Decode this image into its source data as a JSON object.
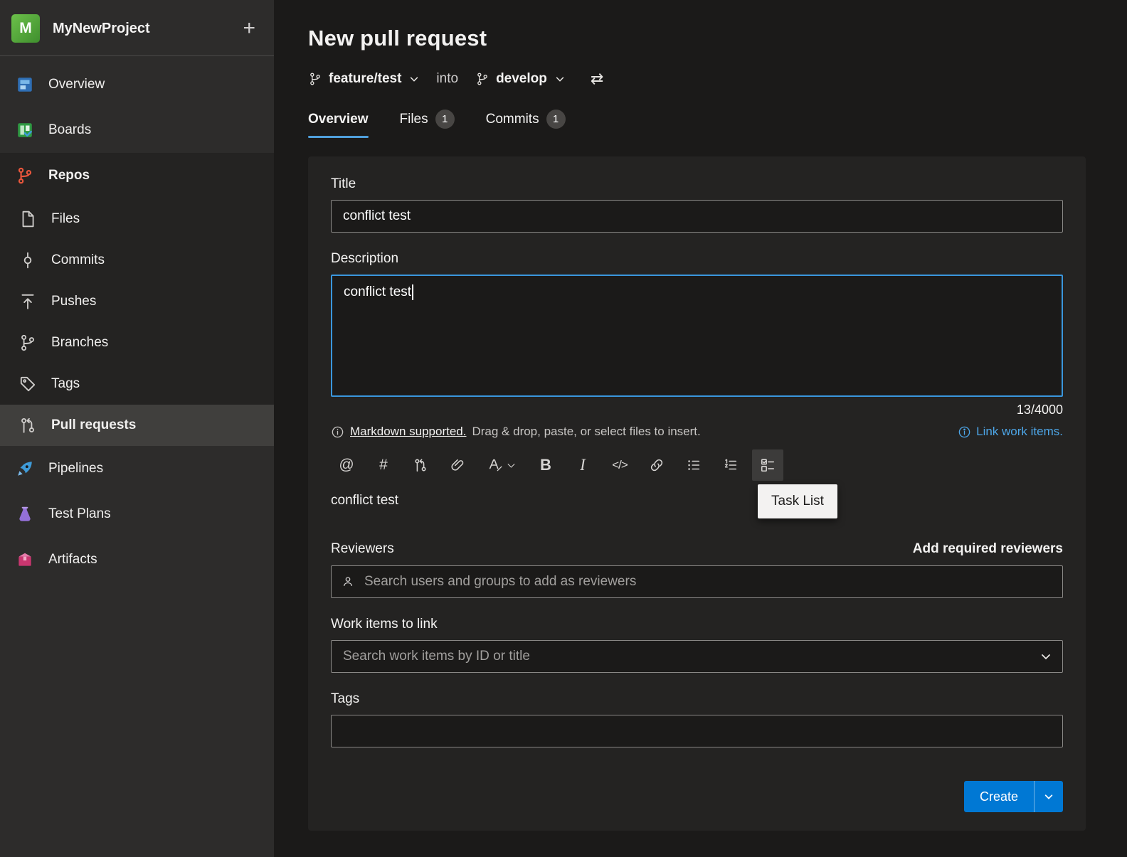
{
  "sidebar": {
    "project": {
      "initial": "M",
      "name": "MyNewProject",
      "add_label": "+"
    },
    "items": [
      {
        "label": "Overview",
        "icon": "overview-icon"
      },
      {
        "label": "Boards",
        "icon": "boards-icon"
      },
      {
        "label": "Repos",
        "icon": "repos-icon"
      },
      {
        "label": "Files",
        "icon": "files-icon"
      },
      {
        "label": "Commits",
        "icon": "commits-icon"
      },
      {
        "label": "Pushes",
        "icon": "pushes-icon"
      },
      {
        "label": "Branches",
        "icon": "branches-icon"
      },
      {
        "label": "Tags",
        "icon": "tags-icon"
      },
      {
        "label": "Pull requests",
        "icon": "pull-requests-icon",
        "selected": true
      },
      {
        "label": "Pipelines",
        "icon": "pipelines-icon"
      },
      {
        "label": "Test Plans",
        "icon": "test-plans-icon"
      },
      {
        "label": "Artifacts",
        "icon": "artifacts-icon"
      }
    ]
  },
  "header": {
    "title": "New pull request",
    "source_branch": "feature/test",
    "into_label": "into",
    "target_branch": "develop",
    "swap_icon": "⇄"
  },
  "tabs": [
    {
      "label": "Overview",
      "active": true
    },
    {
      "label": "Files",
      "badge": "1"
    },
    {
      "label": "Commits",
      "badge": "1"
    }
  ],
  "form": {
    "title_label": "Title",
    "title_value": "conflict test",
    "description_label": "Description",
    "description_value": "conflict test",
    "char_counter": "13/4000",
    "markdown_link": "Markdown supported.",
    "markdown_hint": "Drag & drop, paste, or select files to insert.",
    "link_work_items": "Link work items.",
    "toolbar_icons": [
      "mention",
      "work-item-hash",
      "pull-request",
      "attach",
      "format-text",
      "format-chevron",
      "bold",
      "italic",
      "code",
      "link",
      "bulleted-list",
      "numbered-list",
      "task-list"
    ],
    "tooltip": "Task List",
    "preview_text": "conflict test",
    "reviewers_label": "Reviewers",
    "add_required_reviewers": "Add required reviewers",
    "reviewers_placeholder": "Search users and groups to add as reviewers",
    "work_items_label": "Work items to link",
    "work_items_placeholder": "Search work items by ID or title",
    "tags_label": "Tags",
    "tags_value": "",
    "create_button": "Create"
  },
  "colors": {
    "accent_blue": "#0078d4",
    "tab_underline": "#4f9fdb",
    "focus_border": "#3a96dd",
    "link_blue": "#4da6e8"
  }
}
